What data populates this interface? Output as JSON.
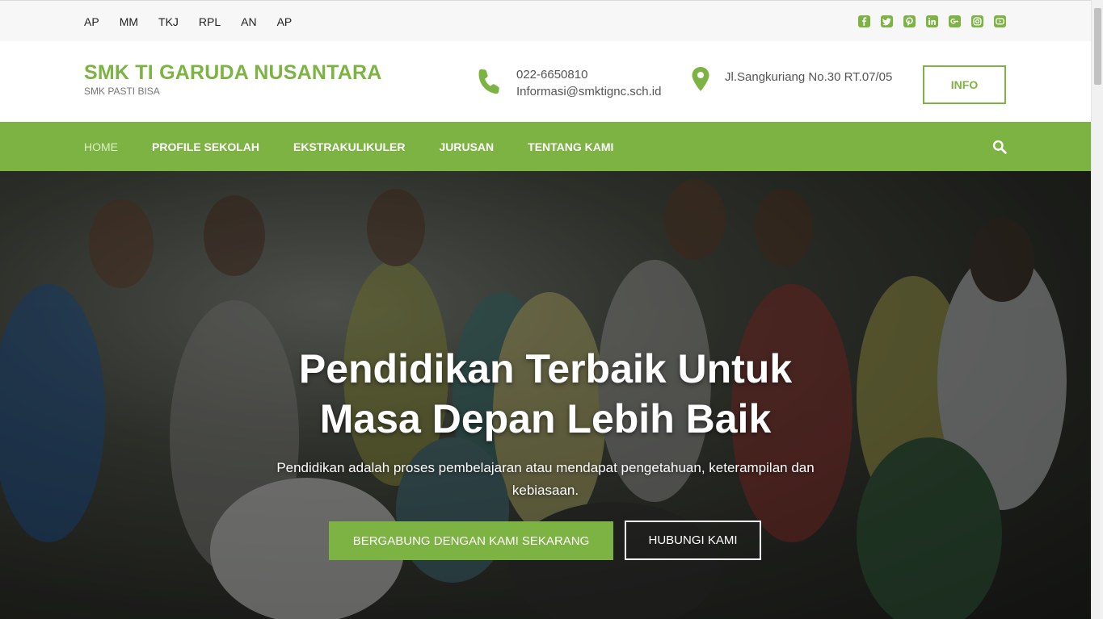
{
  "topbar": {
    "links": [
      "AP",
      "MM",
      "TKJ",
      "RPL",
      "AN",
      "AP"
    ],
    "social_icons": [
      "facebook-icon",
      "twitter-icon",
      "pinterest-icon",
      "linkedin-icon",
      "google-plus-icon",
      "instagram-icon",
      "youtube-icon"
    ]
  },
  "header": {
    "site_title": "SMK TI GARUDA NUSANTARA",
    "tagline": "SMK PASTI BISA",
    "phone": "022-6650810",
    "email": "Informasi@smktignc.sch.id",
    "address": "Jl.Sangkuriang No.30 RT.07/05",
    "info_button": "INFO"
  },
  "nav": {
    "items": [
      "HOME",
      "PROFILE SEKOLAH",
      "EKSTRAKULIKULER",
      "JURUSAN",
      "TENTANG KAMI"
    ],
    "active_index": 0
  },
  "hero": {
    "heading_line1": "Pendidikan Terbaik Untuk",
    "heading_line2": "Masa Depan Lebih Baik",
    "description": "Pendidikan adalah proses pembelajaran atau mendapat pengetahuan, keterampilan dan kebiasaan.",
    "primary_button": "BERGABUNG DENGAN KAMI SEKARANG",
    "secondary_button": "HUBUNGI KAMI"
  },
  "colors": {
    "brand_green": "#7cb342",
    "nav_active": "#dcefc6"
  }
}
